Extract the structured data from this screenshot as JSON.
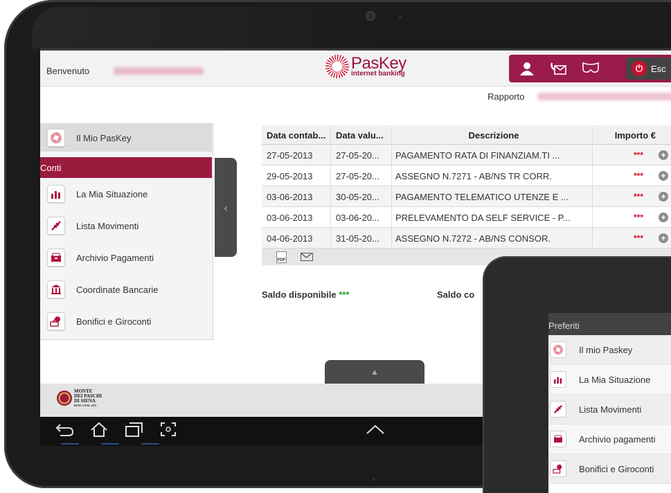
{
  "header": {
    "welcome_label": "Benvenuto",
    "logo_main": "PasKey",
    "logo_sub": "internet banking",
    "exit_label": "Esc",
    "rapporto_label": "Rapporto"
  },
  "sidebar": {
    "home_label": "Il Mio PasKey",
    "section_label": "Conti",
    "items": [
      {
        "label": "La Mia Situazione",
        "icon": "chart-icon"
      },
      {
        "label": "Lista Movimenti",
        "icon": "transfer-arrows-icon"
      },
      {
        "label": "Archivio Pagamenti",
        "icon": "archive-icon"
      },
      {
        "label": "Coordinate Bancarie",
        "icon": "bank-icon"
      },
      {
        "label": "Bonifici e Giroconti",
        "icon": "money-icon"
      }
    ]
  },
  "table": {
    "headers": [
      "Data contab...",
      "Data valu...",
      "Descrizione",
      "Importo €"
    ],
    "rows": [
      {
        "contab": "27-05-2013",
        "valuta": "27-05-20...",
        "desc": "PAGAMENTO RATA DI FINANZIAM.TI ...",
        "importo": "***"
      },
      {
        "contab": "29-05-2013",
        "valuta": "27-05-20...",
        "desc": "ASSEGNO N.7271 - AB/NS TR CORR.",
        "importo": "***"
      },
      {
        "contab": "03-06-2013",
        "valuta": "30-05-20...",
        "desc": "PAGAMENTO TELEMATICO UTENZE E ...",
        "importo": "***"
      },
      {
        "contab": "03-06-2013",
        "valuta": "03-06-20...",
        "desc": "PRELEVAMENTO DA SELF SERVICE - P...",
        "importo": "***"
      },
      {
        "contab": "04-06-2013",
        "valuta": "31-05-20...",
        "desc": "ASSEGNO N.7272 - AB/NS CONSOR.",
        "importo": "***"
      }
    ],
    "pdf_label": "PDF"
  },
  "saldo": {
    "disponibile_label": "Saldo disponibile",
    "disponibile_value": "***",
    "contabile_label": "Saldo co"
  },
  "footer": {
    "bank_line1": "MONTE",
    "bank_line2": "DEI PASCHI",
    "bank_line3": "DI SIENA",
    "bank_line4": "BANCA DAL 1472"
  },
  "phone": {
    "header": "Preferiti",
    "items": [
      "Il mio Paskey",
      "La Mia Situazione",
      "Lista Movimenti",
      "Archivio pagamenti",
      "Bonifici e Giroconti"
    ]
  },
  "colors": {
    "brand": "#9b1b3e",
    "accent_red": "#c8102e",
    "saldo_green": "#2a9d2a"
  }
}
